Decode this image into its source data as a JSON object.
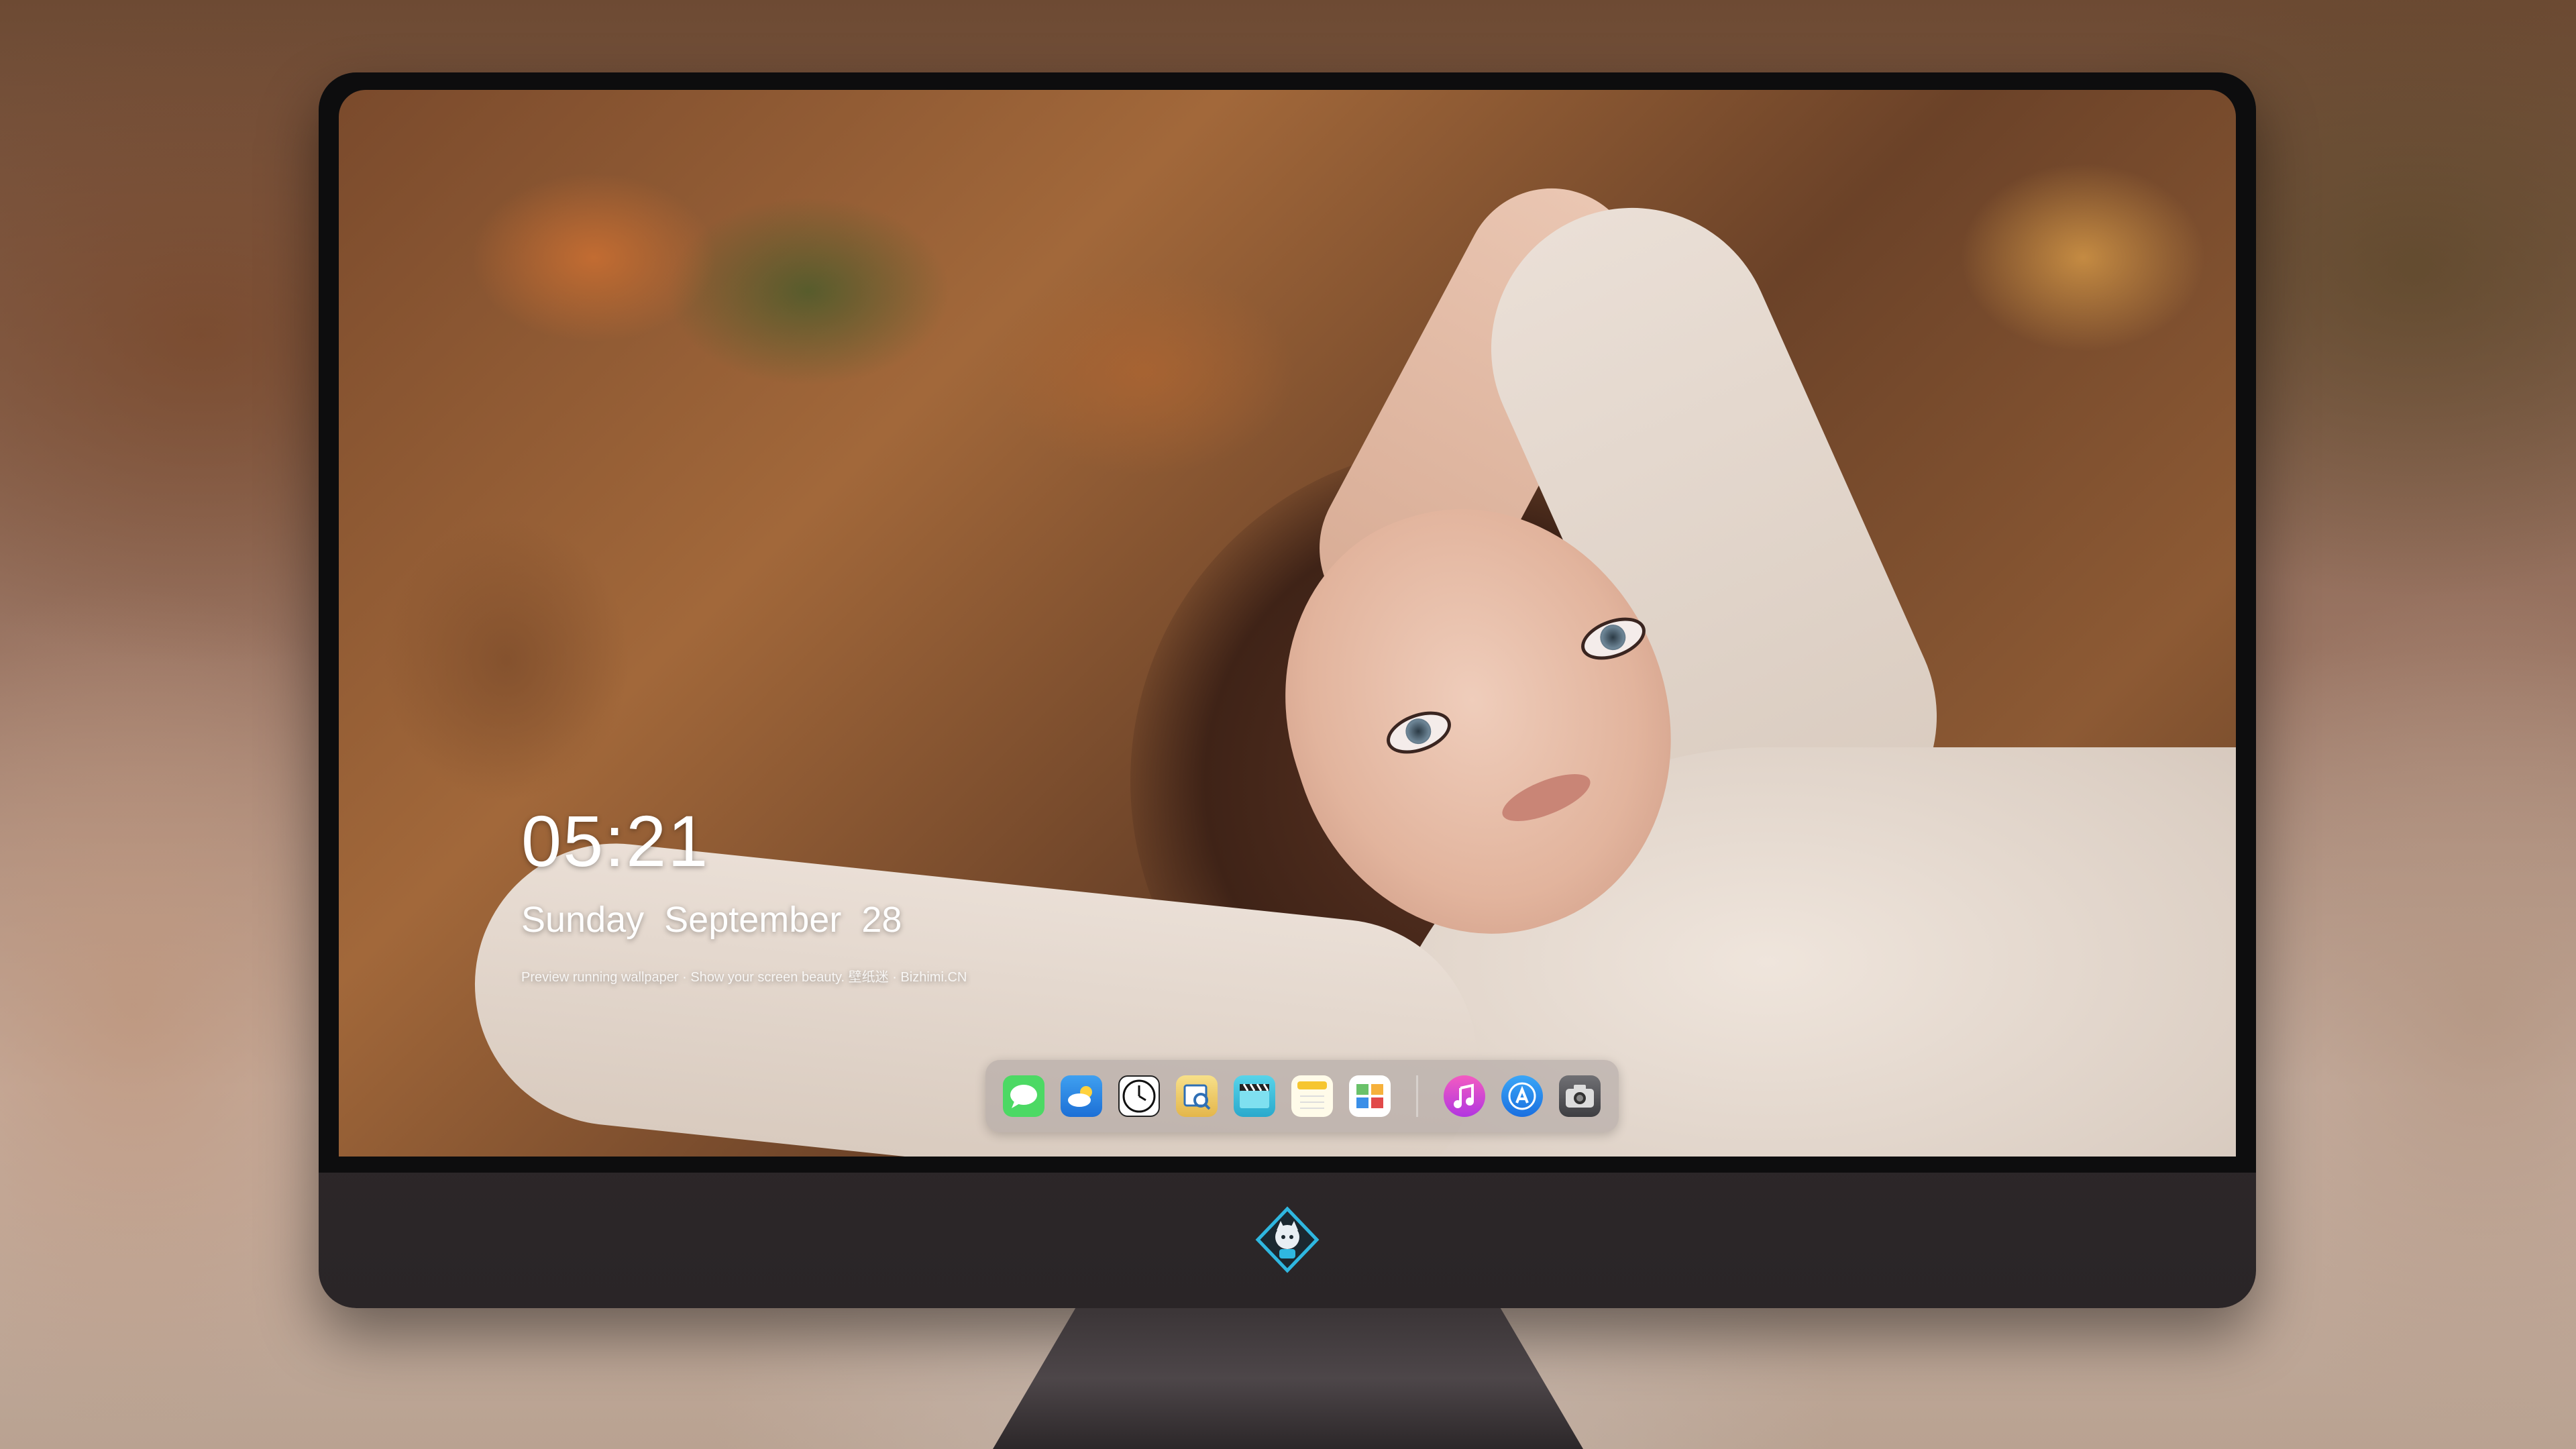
{
  "lock_screen": {
    "time": "05:21",
    "weekday": "Sunday",
    "month": "September",
    "day": "28",
    "footer_text": "Preview running wallpaper · Show your screen beauty. 壁纸迷 · Bizhimi.CN"
  },
  "dock": {
    "items": [
      {
        "name": "messages-icon",
        "glyph": "💬",
        "bg": "#4cd964"
      },
      {
        "name": "weather-icon",
        "glyph": "⛅",
        "bg": "#3a8fe8"
      },
      {
        "name": "clock-icon",
        "glyph": "🕔",
        "bg": "#ffffff"
      },
      {
        "name": "preview-icon",
        "glyph": "🔍",
        "bg": "#f1d36a"
      },
      {
        "name": "video-icon",
        "glyph": "🎬",
        "bg": "#3ec7e0"
      },
      {
        "name": "notes-icon",
        "glyph": "",
        "bg": "#f6c630"
      },
      {
        "name": "photos-icon",
        "glyph": "🗺",
        "bg": "#6ac26a"
      },
      {
        "name": "music-icon",
        "glyph": "♫",
        "bg": "#e14aa8"
      },
      {
        "name": "app-store-icon",
        "glyph": "A",
        "bg": "#2c8ef2"
      },
      {
        "name": "camera-icon",
        "glyph": "📷",
        "bg": "#5a5a5e"
      }
    ]
  },
  "colors": {
    "bezel": "#0d0d0e",
    "chassis": "#2e292b",
    "logo_accent": "#2fb7e0"
  }
}
